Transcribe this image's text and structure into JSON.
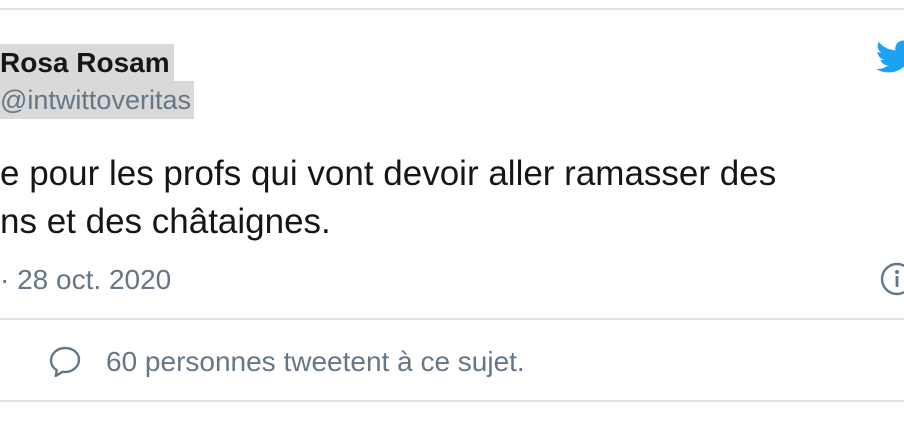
{
  "tweet": {
    "author_name": "Rosa Rosam",
    "author_handle": "@intwittoveritas",
    "text_line_1": "e pour les profs qui vont devoir aller ramasser des",
    "text_line_2": "ns et des châtaignes.",
    "meta": "· 28 oct. 2020",
    "info_icon": "info-icon",
    "brand_icon": "twitter-bird-icon"
  },
  "conversation": {
    "icon": "speech-bubble-icon",
    "label": "60 personnes tweetent à ce sujet."
  },
  "colors": {
    "text": "#14171a",
    "secondary": "#657786",
    "brand": "#1da1f2",
    "divider": "#dfe3e6",
    "highlight": "#d9d9d9"
  }
}
